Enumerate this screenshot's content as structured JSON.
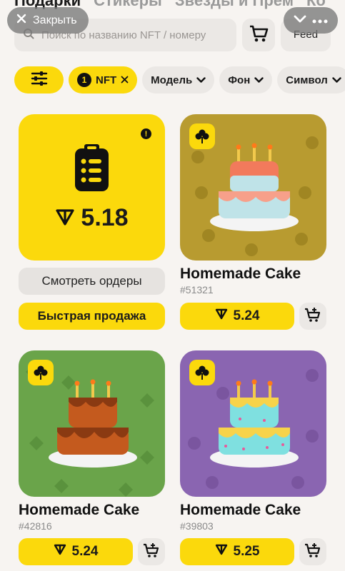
{
  "top_tabs": [
    "Подарки",
    "Стикеры",
    "Звезды и Прем",
    "Ко"
  ],
  "close_label": "Закрыть",
  "search": {
    "placeholder": "Поиск по названию NFT / номеру"
  },
  "feed_label": "Feed",
  "filters": {
    "nft_count": "1",
    "nft_label": "NFT",
    "model_label": "Модель",
    "background_label": "Фон",
    "symbol_label": "Символ"
  },
  "order_card": {
    "price": "5.18",
    "alert": "!"
  },
  "buttons": {
    "view_orders": "Смотреть ордеры",
    "quick_sell": "Быстрая продажа"
  },
  "gifts": [
    {
      "name": "Homemade Cake",
      "number": "#51321",
      "price": "5.24",
      "bg": "#b89b30",
      "pattern": "#9e8422",
      "top_tier": "#f27a5c",
      "bottom_tier": "#bfe3e8",
      "drip": "#f7a08a"
    },
    {
      "name": "Homemade Cake",
      "number": "#42816",
      "price": "5.24",
      "bg": "#6aa44a",
      "pattern": "#5a923d",
      "top_tier": "#c45a1e",
      "bottom_tier": "#c45a1e",
      "drip": "#8a3a12"
    },
    {
      "name": "Homemade Cake",
      "number": "#39803",
      "price": "5.25",
      "bg": "#8a65b1",
      "pattern": "#7a559f",
      "top_tier": "#7fe0e0",
      "bottom_tier": "#7fe0e0",
      "drip": "#f7d34a"
    }
  ],
  "colors": {
    "accent": "#fbd90c",
    "chip": "#ebe8e5",
    "background": "#f7f4f1"
  },
  "icons": [
    "close-icon",
    "chevron-down-icon",
    "search-icon",
    "cart-icon",
    "filter-sliders-icon",
    "clipboard-icon",
    "ton-icon",
    "clover-icon",
    "add-to-cart-icon",
    "alert-icon"
  ]
}
